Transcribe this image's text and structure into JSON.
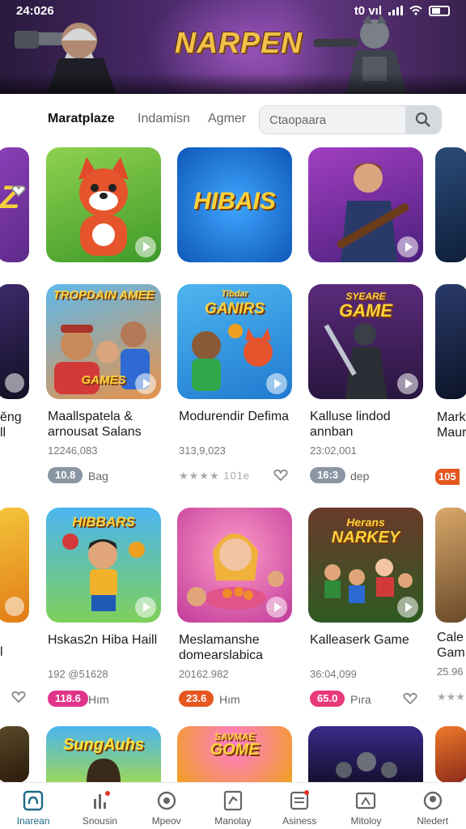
{
  "status_bar": {
    "time": "24:026",
    "right_text": "t0 vıl"
  },
  "banner": {
    "title": "NARPEN"
  },
  "nav": {
    "tabs": [
      {
        "label": "Maratplaze",
        "active": true
      },
      {
        "label": "Indamisn",
        "active": false
      },
      {
        "label": "Agmer",
        "active": false
      }
    ],
    "search_placeholder": "Ctaopaara"
  },
  "top_row": [
    {
      "thumb": "cartoon-fox",
      "title": ""
    },
    {
      "thumb": "hibais-logo",
      "title": "HIBAIS"
    },
    {
      "thumb": "guitarist",
      "title": ""
    }
  ],
  "rows": [
    {
      "cards": [
        {
          "thumb_title_1": "TROPDAIN AMEE",
          "thumb_title_2": "GAMES",
          "name": "Maallspatela & arnousat Salans",
          "meta": "12246,083",
          "badge": "10.8",
          "badge_color": "#8a96a3",
          "tag": "Bag",
          "extra": "heart-left"
        },
        {
          "thumb_title_1": "Tibdar",
          "thumb_title_2": "GANIRS",
          "name": "Modurendir Defima",
          "meta": "313,9,023",
          "badge": "",
          "stars": "★★★★ 101e",
          "tag": "",
          "extra": "heart-right"
        },
        {
          "thumb_title_1": "SYEARE",
          "thumb_title_2": "GAME",
          "name": "Kalluse lindod annban",
          "meta": "23:02,001",
          "badge": "16:3",
          "badge_color": "#8a96a3",
          "tag": "dep",
          "extra": ""
        }
      ],
      "edge_left_name": "ěng\nll",
      "edge_right_name": "Mark\nMaur",
      "edge_right_badge": "105"
    },
    {
      "cards": [
        {
          "thumb_title_1": "HIBBARS",
          "thumb_title_2": "",
          "name": "Hskas2n Hiba Haill",
          "meta": "192 @51628",
          "badge": "118.6",
          "badge_color": "#e0348a",
          "tag": "Hım",
          "extra": "heart-left"
        },
        {
          "thumb_title_1": "",
          "thumb_title_2": "",
          "name": "Meslamanshe domearslabica",
          "meta": "20162.982",
          "badge": "23.6",
          "badge_color": "#e4571f",
          "tag": "Hım",
          "extra": ""
        },
        {
          "thumb_title_1": "Herans",
          "thumb_title_2": "NARKEY",
          "name": "Kalleaserk Game",
          "meta": "36:04,099",
          "badge": "65.0",
          "badge_color": "#e83a7a",
          "tag": "Pıra",
          "extra": "heart-right"
        }
      ],
      "edge_left_name": "l",
      "edge_right_name": "Cale\nGam",
      "edge_right_meta": "25.96"
    },
    {
      "cards": [
        {
          "thumb_title_1": "SungAuhs",
          "thumb_title_2": ""
        },
        {
          "thumb_title_1": "SAVMAE",
          "thumb_title_2": "GOME"
        },
        {
          "thumb_title_1": "",
          "thumb_title_2": ""
        }
      ]
    }
  ],
  "bottom_nav": [
    {
      "label": "Inarean",
      "icon": "home-icon",
      "active": true
    },
    {
      "label": "Snousin",
      "icon": "chart-icon",
      "active": false
    },
    {
      "label": "Mpeov",
      "icon": "gamepad-icon",
      "active": false
    },
    {
      "label": "Manolay",
      "icon": "library-icon",
      "active": false
    },
    {
      "label": "Asiness",
      "icon": "list-icon",
      "active": false
    },
    {
      "label": "Mitoloy",
      "icon": "tv-icon",
      "active": false
    },
    {
      "label": "Nledert",
      "icon": "profile-icon",
      "active": false
    }
  ]
}
